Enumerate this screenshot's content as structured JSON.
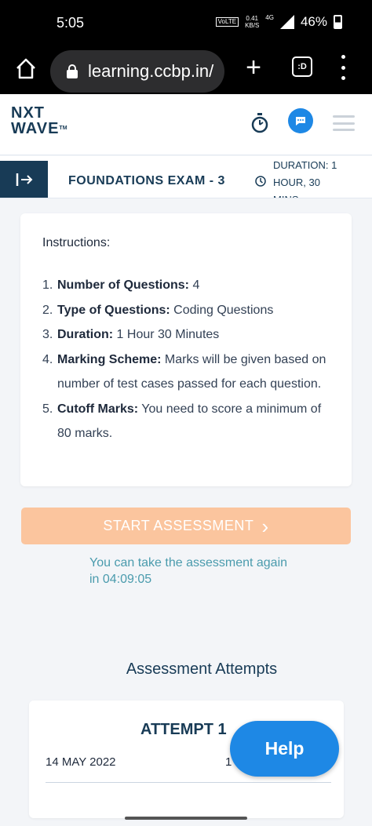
{
  "status_bar": {
    "time": "5:05",
    "network_tag": "VoLTE",
    "speed_value": "0.41",
    "speed_unit": "KB/S",
    "network_type": "4G",
    "battery": "46%"
  },
  "browser": {
    "url": "learning.ccbp.in/",
    "tabs_label": ":D"
  },
  "header": {
    "logo_line1": "NXT",
    "logo_line2": "WAVE",
    "logo_tm": "TM"
  },
  "exam": {
    "title": "FOUNDATIONS EXAM - 3",
    "duration_line1": "DURATION: 1",
    "duration_line2": "HOUR, 30",
    "duration_line3": "MINS"
  },
  "instructions": {
    "heading": "Instructions:",
    "items": [
      {
        "num": "1.",
        "label": "Number of Questions:",
        "text": " 4"
      },
      {
        "num": "2.",
        "label": "Type of Questions:",
        "text": " Coding Questions"
      },
      {
        "num": "3.",
        "label": "Duration:",
        "text": " 1 Hour 30 Minutes"
      },
      {
        "num": "4.",
        "label": "Marking Scheme:",
        "text": " Marks will be given based on number of test cases passed for each question."
      },
      {
        "num": "5.",
        "label": "Cutoff Marks:",
        "text": " You need to score a minimum of 80 marks."
      }
    ]
  },
  "start_button": {
    "label": "START ASSESSMENT",
    "chevron": "›"
  },
  "retake_note": "You can take the assessment again in 04:09:05",
  "attempts": {
    "heading": "Assessment Attempts",
    "items": [
      {
        "title": "ATTEMPT 1",
        "date": "14 MAY 2022",
        "time_partial": "1"
      }
    ]
  },
  "help_button": {
    "label": "Help"
  },
  "colors": {
    "brand_navy": "#183b56",
    "start_button": "#fbc59e",
    "help_blue": "#1e88e5",
    "teal_note": "#4a9bad"
  }
}
